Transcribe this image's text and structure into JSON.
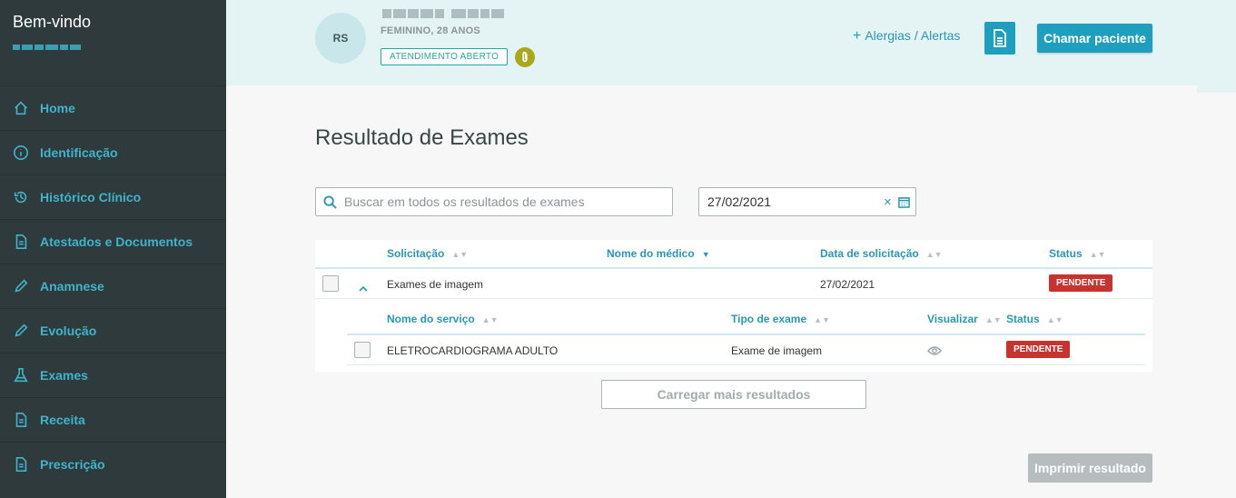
{
  "sidebar": {
    "welcome": "Bem-vindo",
    "items": [
      {
        "label": "Home",
        "icon": "home-icon"
      },
      {
        "label": "Identificação",
        "icon": "info-icon"
      },
      {
        "label": "Histórico Clínico",
        "icon": "history-icon"
      },
      {
        "label": "Atestados e Documentos",
        "icon": "document-icon"
      },
      {
        "label": "Anamnese",
        "icon": "pencil-icon"
      },
      {
        "label": "Evolução",
        "icon": "pencil-icon"
      },
      {
        "label": "Exames",
        "icon": "flask-icon"
      },
      {
        "label": "Receita",
        "icon": "document-icon"
      },
      {
        "label": "Prescrição",
        "icon": "document-icon"
      }
    ]
  },
  "header": {
    "initials": "RS",
    "patient_info": "FEMININO, 28 ANOS",
    "status": "ATENDIMENTO ABERTO",
    "alerts": "Alergias / Alertas",
    "alerts_plus": "+",
    "call_patient": "Chamar paciente"
  },
  "main": {
    "title": "Resultado de Exames",
    "search_placeholder": "Buscar em todos os resultados de exames",
    "date_value": "27/02/2021",
    "date_clear": "×",
    "table": {
      "columns": [
        "Solicitação",
        "Nome do médico",
        "Data de solicitação",
        "Status"
      ],
      "row": {
        "solicitacao": "Exames de imagem",
        "data": "27/02/2021",
        "status": "PENDENTE"
      },
      "sub_columns": [
        "Nome do serviço",
        "Tipo de exame",
        "Visualizar",
        "Status"
      ],
      "sub_row": {
        "servico": "ELETROCARDIOGRAMA ADULTO",
        "tipo": "Exame de imagem",
        "status": "PENDENTE"
      }
    },
    "load_more": "Carregar mais resultados",
    "print": "Imprimir resultado"
  },
  "colors": {
    "sidebar_bg": "#2e3a3b",
    "accent": "#1f9fbe",
    "pending": "#c8322f",
    "header_bg": "#e4f3f4"
  }
}
